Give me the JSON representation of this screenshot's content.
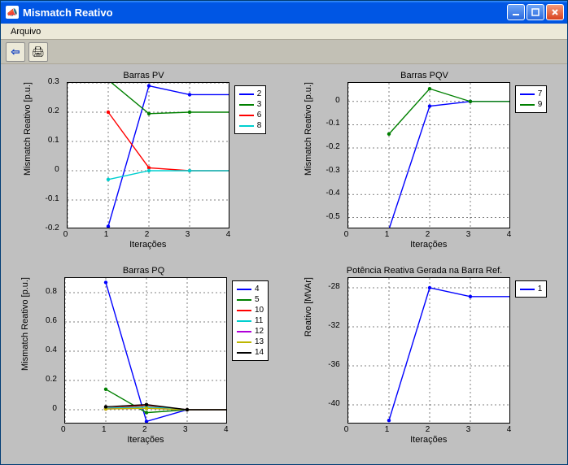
{
  "window": {
    "title": "Mismatch Reativo",
    "app_icon_glyph": "📣"
  },
  "menubar": {
    "file": "Arquivo"
  },
  "toolbar": {
    "back_glyph": "⇦",
    "print_glyph": "🖨"
  },
  "chart_data": [
    {
      "type": "line",
      "title": "Barras PV",
      "xlabel": "Iterações",
      "ylabel": "Mismatch Reativo [p.u.]",
      "xlim": [
        0,
        4
      ],
      "ylim": [
        -0.2,
        0.3
      ],
      "xticks": [
        0,
        1,
        2,
        3,
        4
      ],
      "yticks": [
        -0.2,
        -0.1,
        0,
        0.1,
        0.2,
        0.3
      ],
      "series": [
        {
          "name": "2",
          "color": "#0000ff",
          "x": [
            1,
            2,
            3,
            4
          ],
          "y": [
            -0.19,
            0.29,
            0.26,
            0.26
          ]
        },
        {
          "name": "3",
          "color": "#008000",
          "x": [
            1,
            2,
            3,
            4
          ],
          "y": [
            0.31,
            0.195,
            0.2,
            0.2
          ]
        },
        {
          "name": "6",
          "color": "#ff0000",
          "x": [
            1,
            2,
            3,
            4
          ],
          "y": [
            0.2,
            0.01,
            0.0,
            0.0
          ]
        },
        {
          "name": "8",
          "color": "#00cfcf",
          "x": [
            1,
            2,
            3,
            4
          ],
          "y": [
            -0.03,
            0.0,
            0.0,
            0.0
          ]
        }
      ]
    },
    {
      "type": "line",
      "title": "Barras PQV",
      "xlabel": "Iterações",
      "ylabel": "Mismatch Reativo [p.u.]",
      "xlim": [
        0,
        4
      ],
      "ylim": [
        -0.55,
        0.08
      ],
      "xticks": [
        0,
        1,
        2,
        3,
        4
      ],
      "yticks": [
        -0.5,
        -0.4,
        -0.3,
        -0.2,
        -0.1,
        0
      ],
      "series": [
        {
          "name": "7",
          "color": "#0000ff",
          "x": [
            1,
            2,
            3,
            4
          ],
          "y": [
            -0.55,
            -0.02,
            0.0,
            0.0
          ]
        },
        {
          "name": "9",
          "color": "#008000",
          "x": [
            1,
            2,
            3,
            4
          ],
          "y": [
            -0.14,
            0.055,
            0.0,
            0.0
          ]
        }
      ]
    },
    {
      "type": "line",
      "title": "Barras PQ",
      "xlabel": "Iterações",
      "ylabel": "Mismatch Reativo [p.u.]",
      "xlim": [
        0,
        4
      ],
      "ylim": [
        -0.1,
        0.9
      ],
      "xticks": [
        0,
        1,
        2,
        3,
        4
      ],
      "yticks": [
        0,
        0.2,
        0.4,
        0.6,
        0.8
      ],
      "series": [
        {
          "name": "4",
          "color": "#0000ff",
          "x": [
            1,
            2,
            3,
            4
          ],
          "y": [
            0.87,
            -0.08,
            0.0,
            0.0
          ]
        },
        {
          "name": "5",
          "color": "#008000",
          "x": [
            1,
            2,
            3,
            4
          ],
          "y": [
            0.14,
            -0.02,
            0.0,
            0.0
          ]
        },
        {
          "name": "10",
          "color": "#ff0000",
          "x": [
            1,
            2,
            3,
            4
          ],
          "y": [
            0.01,
            0.03,
            0.0,
            0.0
          ]
        },
        {
          "name": "11",
          "color": "#00cfcf",
          "x": [
            1,
            2,
            3,
            4
          ],
          "y": [
            0.01,
            0.02,
            0.0,
            0.0
          ]
        },
        {
          "name": "12",
          "color": "#b000d8",
          "x": [
            1,
            2,
            3,
            4
          ],
          "y": [
            0.005,
            0.01,
            0.0,
            0.0
          ]
        },
        {
          "name": "13",
          "color": "#bdb600",
          "x": [
            1,
            2,
            3,
            4
          ],
          "y": [
            0.005,
            0.01,
            0.0,
            0.0
          ]
        },
        {
          "name": "14",
          "color": "#000000",
          "x": [
            1,
            2,
            3,
            4
          ],
          "y": [
            0.02,
            0.035,
            0.0,
            0.0
          ]
        }
      ]
    },
    {
      "type": "line",
      "title": "Potência Reativa Gerada na Barra Ref.",
      "xlabel": "Iterações",
      "ylabel": "Reativo [MVAr]",
      "xlim": [
        0,
        4
      ],
      "ylim": [
        -42,
        -27
      ],
      "xticks": [
        0,
        1,
        2,
        3,
        4
      ],
      "yticks": [
        -40,
        -36,
        -32,
        -28
      ],
      "series": [
        {
          "name": "1",
          "color": "#0000ff",
          "x": [
            1,
            2,
            3,
            4
          ],
          "y": [
            -41.6,
            -28.0,
            -28.9,
            -28.9
          ]
        }
      ]
    }
  ]
}
